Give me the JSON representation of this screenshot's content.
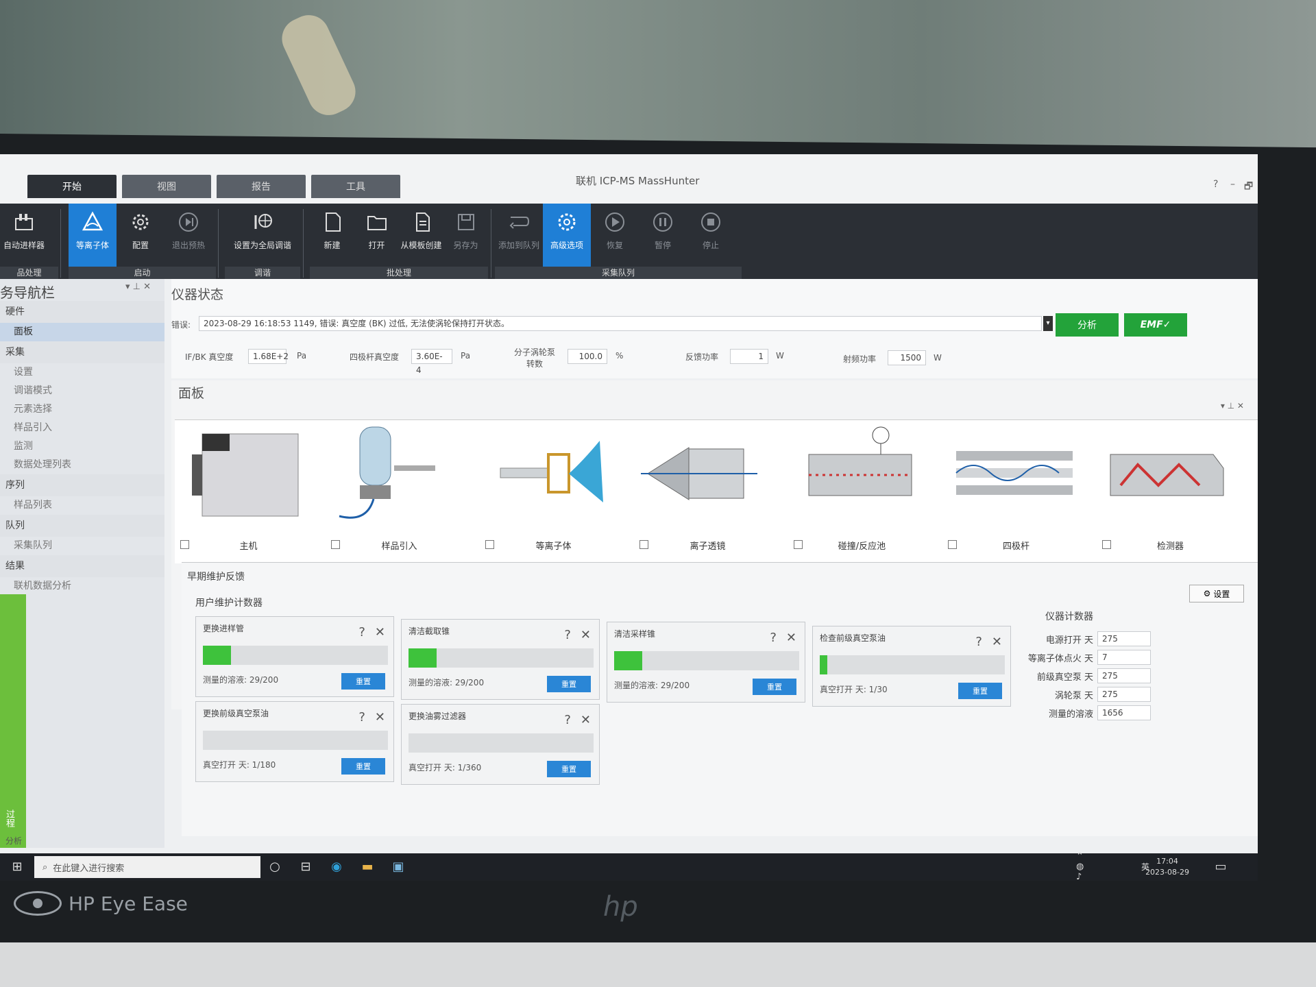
{
  "app": {
    "title": "联机 ICP-MS MassHunter",
    "window_controls": [
      "?",
      "–",
      "🗗"
    ]
  },
  "tabs": [
    "开始",
    "视图",
    "报告",
    "工具"
  ],
  "ribbon": {
    "groups": [
      {
        "name": "品处理",
        "buttons": [
          {
            "label": "自动进样器",
            "icon": "autosampler-icon"
          }
        ]
      },
      {
        "name": "启动",
        "buttons": [
          {
            "label": "等离子体",
            "icon": "plasma-icon",
            "highlight": true
          },
          {
            "label": "配置",
            "icon": "gear-icon"
          },
          {
            "label": "退出预热",
            "icon": "skip-icon",
            "dim": true
          }
        ]
      },
      {
        "name": "调谐",
        "buttons": [
          {
            "label": "设置为全局调谐",
            "icon": "globe-tune-icon"
          }
        ]
      },
      {
        "name": "批处理",
        "buttons": [
          {
            "label": "新建",
            "icon": "new-file-icon"
          },
          {
            "label": "打开",
            "icon": "folder-open-icon"
          },
          {
            "label": "从模板创建",
            "icon": "template-icon"
          },
          {
            "label": "另存为",
            "icon": "save-as-icon",
            "dim": true
          }
        ]
      },
      {
        "name": "采集队列",
        "buttons": [
          {
            "label": "添加到队列",
            "icon": "add-queue-icon",
            "dim": true
          },
          {
            "label": "高级选项",
            "icon": "advanced-gear-icon",
            "highlight": true
          },
          {
            "label": "恢复",
            "icon": "play-icon",
            "dim": true
          },
          {
            "label": "暂停",
            "icon": "pause-icon",
            "dim": true
          },
          {
            "label": "停止",
            "icon": "stop-icon",
            "dim": true
          }
        ]
      }
    ]
  },
  "sidebar": {
    "title": "务导航栏",
    "sections": [
      {
        "label": "硬件",
        "kind": "head"
      },
      {
        "label": "面板",
        "kind": "selected"
      },
      {
        "label": "采集",
        "kind": "head"
      },
      {
        "label": "设置",
        "kind": "item"
      },
      {
        "label": "调谐模式",
        "kind": "item"
      },
      {
        "label": "元素选择",
        "kind": "item"
      },
      {
        "label": "样品引入",
        "kind": "item"
      },
      {
        "label": "监测",
        "kind": "item"
      },
      {
        "label": "数据处理列表",
        "kind": "item"
      },
      {
        "label": "序列",
        "kind": "head"
      },
      {
        "label": "样品列表",
        "kind": "item"
      },
      {
        "label": "队列",
        "kind": "head"
      },
      {
        "label": "采集队列",
        "kind": "item"
      },
      {
        "label": "结果",
        "kind": "head"
      },
      {
        "label": "联机数据分析",
        "kind": "item"
      }
    ],
    "bottom_labels": [
      "分析",
      "过程"
    ]
  },
  "status": {
    "title": "仪器状态",
    "error_label": "错误:",
    "error_text": "2023-08-29 16:18:53 1149, 错误: 真空度 (BK) 过低, 无法使涡轮保持打开状态。",
    "analysis_button": "分析",
    "emf_button": "EMF✓",
    "readings": [
      {
        "label": "IF/BK 真空度",
        "value": "1.68E+2",
        "unit": "Pa"
      },
      {
        "label": "四极杆真空度",
        "value": "3.60E-4",
        "unit": "Pa"
      },
      {
        "label": "分子涡轮泵 转数",
        "value": "100.0",
        "unit": "%"
      },
      {
        "label": "反馈功率",
        "value": "1",
        "unit": "W"
      },
      {
        "label": "射频功率",
        "value": "1500",
        "unit": "W"
      }
    ]
  },
  "panel": {
    "title": "面板",
    "components": [
      "主机",
      "样品引入",
      "等离子体",
      "离子透镜",
      "碰撞/反应池",
      "四极杆",
      "检测器"
    ]
  },
  "maintenance": {
    "title": "早期维护反馈",
    "settings_button": "设置",
    "user_counters_title": "用户维护计数器",
    "cards": [
      {
        "title": "更换进样管",
        "status": "测量的溶液: 29/200",
        "progress": 0.15,
        "reset": "重置"
      },
      {
        "title": "清洁截取锥",
        "status": "测量的溶液: 29/200",
        "progress": 0.15,
        "reset": "重置"
      },
      {
        "title": "清洁采样锥",
        "status": "测量的溶液: 29/200",
        "progress": 0.15,
        "reset": "重置"
      },
      {
        "title": "检查前级真空泵油",
        "status": "真空打开 天: 1/30",
        "progress": 0.04,
        "reset": "重置"
      },
      {
        "title": "更换前级真空泵油",
        "status": "真空打开 天: 1/180",
        "progress": 0.0,
        "reset": "重置"
      },
      {
        "title": "更换油雾过滤器",
        "status": "真空打开 天: 1/360",
        "progress": 0.0,
        "reset": "重置"
      }
    ],
    "instrument_counters_title": "仪器计数器",
    "instrument_counters": [
      {
        "label": "电源打开 天",
        "value": "275"
      },
      {
        "label": "等离子体点火 天",
        "value": "7"
      },
      {
        "label": "前级真空泵 天",
        "value": "275"
      },
      {
        "label": "涡轮泵 天",
        "value": "275"
      },
      {
        "label": "测量的溶液",
        "value": "1656"
      }
    ]
  },
  "taskbar": {
    "search_placeholder": "在此键入进行搜索",
    "time": "17:04",
    "date": "2023-08-29",
    "ime": "英"
  },
  "bezel": {
    "eye_ease": "HP Eye Ease",
    "brand": "hp"
  },
  "colors": {
    "accent_blue": "#1f7fd6",
    "green": "#23a33a",
    "progress_green": "#3ec23c"
  }
}
